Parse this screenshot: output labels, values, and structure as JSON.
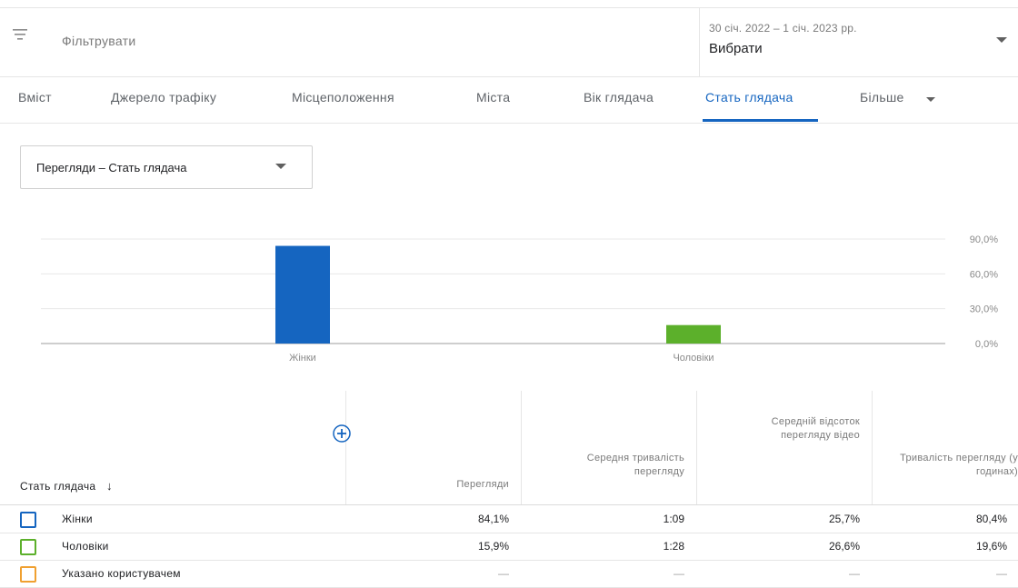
{
  "filter": {
    "icon": "filter-icon",
    "placeholder": "Фільтрувати"
  },
  "date": {
    "range": "30 січ. 2022 – 1 січ. 2023 рр.",
    "label": "Вибрати"
  },
  "tabs": [
    {
      "label": "Вміст"
    },
    {
      "label": "Джерело трафіку"
    },
    {
      "label": "Місцеположення"
    },
    {
      "label": "Міста"
    },
    {
      "label": "Вік глядача"
    },
    {
      "label": "Стать глядача",
      "active": true
    },
    {
      "label": "Більше"
    }
  ],
  "metric_select": {
    "label": "Перегляди – Стать глядача"
  },
  "chart_data": {
    "type": "bar",
    "categories": [
      "Жінки",
      "Чоловіки"
    ],
    "values": [
      84.1,
      15.9
    ],
    "colors": [
      "#1565c0",
      "#5cb02b"
    ],
    "ylim": [
      0,
      100
    ],
    "yticks": [
      "0,0%",
      "30,0%",
      "60,0%",
      "90,0%"
    ],
    "grid": true
  },
  "table": {
    "columns": [
      "Стать глядача",
      "Перегляди",
      "Середня тривалість перегляду",
      "Середній відсоток перегляду відео",
      "Тривалість перегляду (у годинах)"
    ],
    "rows": [
      {
        "name": "Жінки",
        "color": "#1565c0",
        "values": [
          "84,1%",
          "1:09",
          "25,7%",
          "80,4%"
        ]
      },
      {
        "name": "Чоловіки",
        "color": "#5cb02b",
        "values": [
          "15,9%",
          "1:28",
          "26,6%",
          "19,6%"
        ]
      },
      {
        "name": "Указано користувачем",
        "color": "#f0a030",
        "values": [
          "—",
          "—",
          "—",
          "—"
        ]
      }
    ]
  }
}
